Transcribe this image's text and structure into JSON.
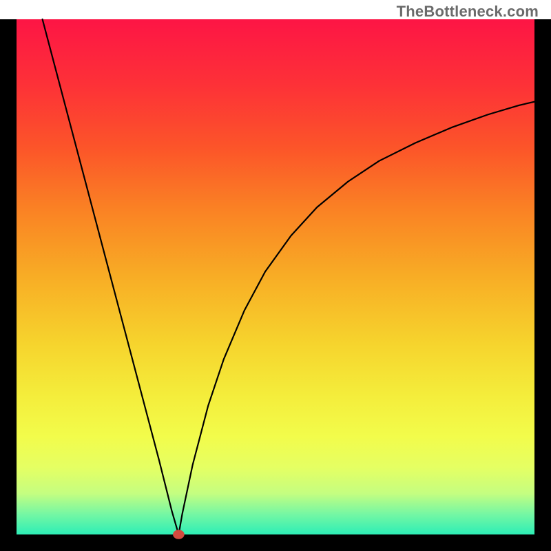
{
  "watermark": "TheBottleneck.com",
  "chart_data": {
    "type": "line",
    "title": "",
    "xlabel": "",
    "ylabel": "",
    "xlim": [
      0,
      100
    ],
    "ylim": [
      0,
      100
    ],
    "grid": false,
    "legend": false,
    "background_gradient": {
      "stops": [
        {
          "pos": 0.0,
          "color": "#fd1545"
        },
        {
          "pos": 0.13,
          "color": "#fd3237"
        },
        {
          "pos": 0.25,
          "color": "#fc5529"
        },
        {
          "pos": 0.37,
          "color": "#fa8224"
        },
        {
          "pos": 0.5,
          "color": "#f8ad25"
        },
        {
          "pos": 0.63,
          "color": "#f6d42d"
        },
        {
          "pos": 0.73,
          "color": "#f4ed3b"
        },
        {
          "pos": 0.81,
          "color": "#f2fc4b"
        },
        {
          "pos": 0.87,
          "color": "#e5ff63"
        },
        {
          "pos": 0.92,
          "color": "#c5fe80"
        },
        {
          "pos": 0.96,
          "color": "#76f7a3"
        },
        {
          "pos": 1.0,
          "color": "#2deeb6"
        }
      ]
    },
    "series": [
      {
        "name": "bottleneck-curve",
        "color": "#000000",
        "stroke_width": 2.2,
        "x": [
          5.0,
          7.5,
          10.0,
          12.5,
          15.0,
          17.5,
          20.0,
          22.5,
          25.0,
          27.5,
          29.0,
          30.0,
          31.3,
          31.3,
          32.0,
          34.0,
          37.0,
          40.0,
          44.0,
          48.0,
          53.0,
          58.0,
          64.0,
          70.0,
          77.0,
          84.0,
          91.0,
          97.0,
          100.0
        ],
        "y": [
          100.0,
          90.5,
          81.0,
          71.5,
          62.0,
          52.5,
          43.0,
          33.5,
          24.0,
          14.5,
          8.5,
          4.5,
          0.0,
          0.0,
          4.0,
          13.5,
          25.0,
          34.0,
          43.5,
          51.0,
          58.0,
          63.5,
          68.5,
          72.5,
          76.0,
          79.0,
          81.5,
          83.3,
          84.0
        ]
      }
    ],
    "marker": {
      "name": "optimal-point",
      "x": 31.3,
      "y": 0.0,
      "rx": 1.1,
      "ry": 0.9,
      "color": "#d24a3f"
    },
    "frame": {
      "outer_color": "#000000",
      "outer_thickness_pct": {
        "left": 3.0,
        "right": 3.0,
        "top": 0.0,
        "bottom": 3.0
      }
    }
  }
}
